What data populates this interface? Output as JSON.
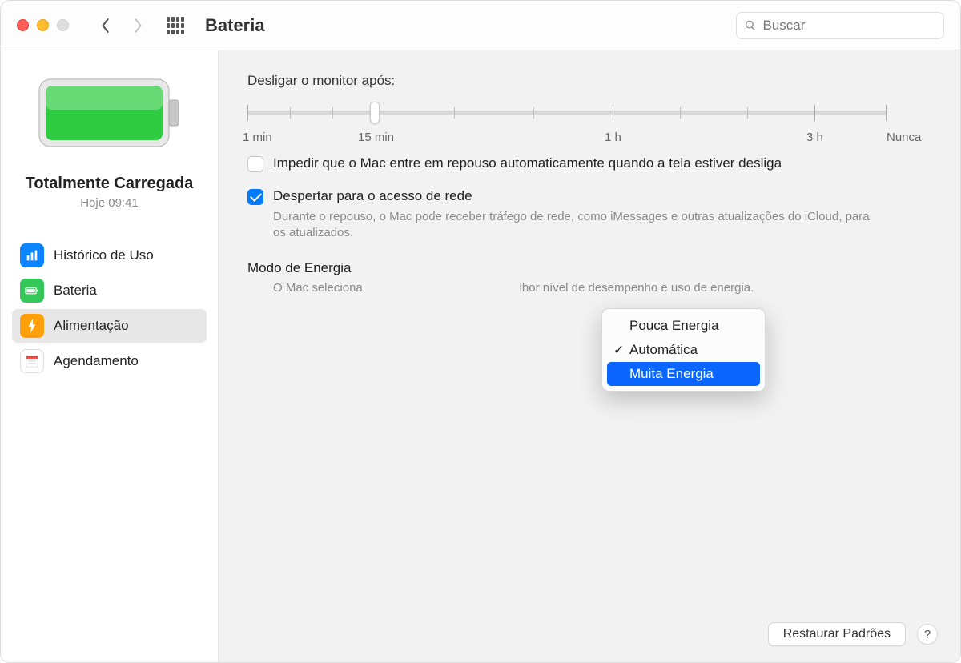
{
  "header": {
    "title": "Bateria",
    "search_placeholder": "Buscar"
  },
  "sidebar": {
    "status_title": "Totalmente Carregada",
    "status_sub": "Hoje 09:41",
    "items": [
      {
        "label": "Histórico de Uso"
      },
      {
        "label": "Bateria"
      },
      {
        "label": "Alimentação"
      },
      {
        "label": "Agendamento"
      }
    ]
  },
  "main": {
    "slider_label": "Desligar o monitor após:",
    "slider_ticks": [
      "1 min",
      "15 min",
      "1 h",
      "3 h",
      "Nunca"
    ],
    "checkbox_prevent_sleep": "Impedir que o Mac entre em repouso automaticamente quando a tela estiver desliga",
    "checkbox_wake_network": "Despertar para o acesso de rede",
    "wake_network_desc": "Durante o repouso, o Mac pode receber tráfego de rede, como iMessages e outras atualizações do iCloud, para                                                         os atualizados.",
    "energy_mode_label": "Modo de Energia",
    "energy_mode_desc": "O Mac seleciona                                               lhor nível de desempenho e uso de energia.",
    "restore_button": "Restaurar Padrões",
    "help": "?"
  },
  "dropdown": {
    "options": [
      "Pouca Energia",
      "Automática",
      "Muita Energia"
    ],
    "checked_index": 1,
    "highlighted_index": 2
  },
  "colors": {
    "accent": "#007aff",
    "highlight": "#0a66ff"
  }
}
